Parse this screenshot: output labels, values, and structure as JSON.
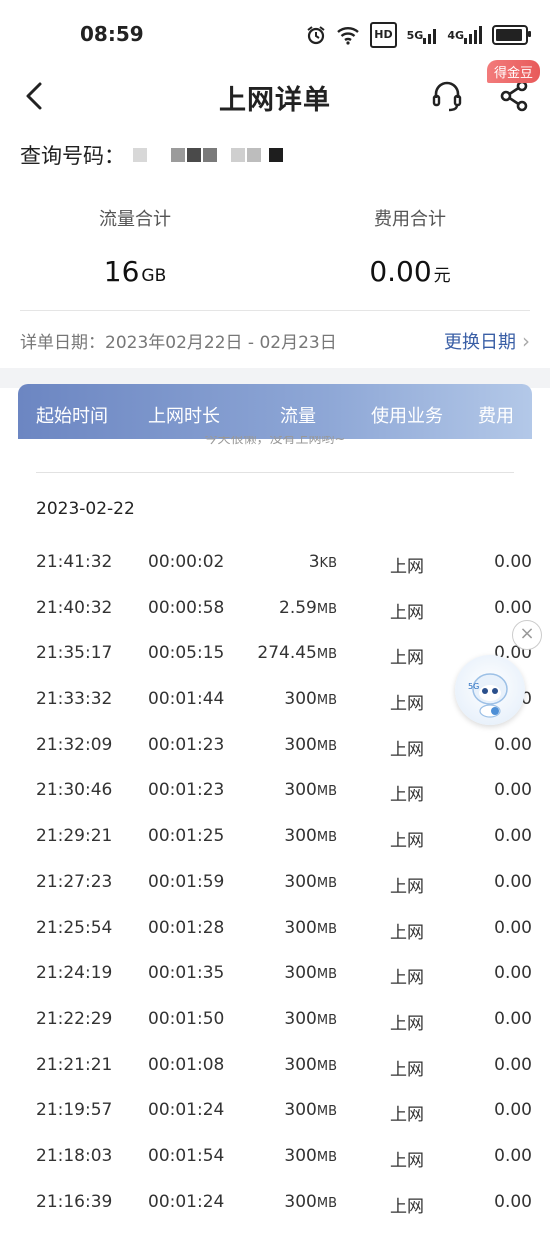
{
  "status_bar": {
    "time": "08:59",
    "hd_label": "HD",
    "net_5g": "5G",
    "net_4g": "4G"
  },
  "nav": {
    "title": "上网详单",
    "coin_badge": "得金豆"
  },
  "query": {
    "label": "查询号码："
  },
  "totals": {
    "traffic_label": "流量合计",
    "traffic_value": "16",
    "traffic_unit": "GB",
    "fee_label": "费用合计",
    "fee_value": "0.00",
    "fee_unit": "元"
  },
  "date_range": {
    "label": "详单日期：2023年02月22日 - 02月23日",
    "change_link": "更换日期"
  },
  "table": {
    "headers": [
      "起始时间",
      "上网时长",
      "流量",
      "使用业务",
      "费用"
    ],
    "empty_tip": "今天很懒，没有上网哟~",
    "group_date": "2023-02-22",
    "rows": [
      {
        "start": "21:41:32",
        "duration": "00:00:02",
        "traffic": "3",
        "unit": "KB",
        "business": "上网",
        "fee": "0.00"
      },
      {
        "start": "21:40:32",
        "duration": "00:00:58",
        "traffic": "2.59",
        "unit": "MB",
        "business": "上网",
        "fee": "0.00"
      },
      {
        "start": "21:35:17",
        "duration": "00:05:15",
        "traffic": "274.45",
        "unit": "MB",
        "business": "上网",
        "fee": "0.00"
      },
      {
        "start": "21:33:32",
        "duration": "00:01:44",
        "traffic": "300",
        "unit": "MB",
        "business": "上网",
        "fee": "0.00"
      },
      {
        "start": "21:32:09",
        "duration": "00:01:23",
        "traffic": "300",
        "unit": "MB",
        "business": "上网",
        "fee": "0.00"
      },
      {
        "start": "21:30:46",
        "duration": "00:01:23",
        "traffic": "300",
        "unit": "MB",
        "business": "上网",
        "fee": "0.00"
      },
      {
        "start": "21:29:21",
        "duration": "00:01:25",
        "traffic": "300",
        "unit": "MB",
        "business": "上网",
        "fee": "0.00"
      },
      {
        "start": "21:27:23",
        "duration": "00:01:59",
        "traffic": "300",
        "unit": "MB",
        "business": "上网",
        "fee": "0.00"
      },
      {
        "start": "21:25:54",
        "duration": "00:01:28",
        "traffic": "300",
        "unit": "MB",
        "business": "上网",
        "fee": "0.00"
      },
      {
        "start": "21:24:19",
        "duration": "00:01:35",
        "traffic": "300",
        "unit": "MB",
        "business": "上网",
        "fee": "0.00"
      },
      {
        "start": "21:22:29",
        "duration": "00:01:50",
        "traffic": "300",
        "unit": "MB",
        "business": "上网",
        "fee": "0.00"
      },
      {
        "start": "21:21:21",
        "duration": "00:01:08",
        "traffic": "300",
        "unit": "MB",
        "business": "上网",
        "fee": "0.00"
      },
      {
        "start": "21:19:57",
        "duration": "00:01:24",
        "traffic": "300",
        "unit": "MB",
        "business": "上网",
        "fee": "0.00"
      },
      {
        "start": "21:18:03",
        "duration": "00:01:54",
        "traffic": "300",
        "unit": "MB",
        "business": "上网",
        "fee": "0.00"
      },
      {
        "start": "21:16:39",
        "duration": "00:01:24",
        "traffic": "300",
        "unit": "MB",
        "business": "上网",
        "fee": "0.00"
      }
    ]
  },
  "floating": {
    "assistant_badge": "5G"
  },
  "colors": {
    "accent_link": "#3a5fa6",
    "header_gradient_start": "#6c86c2",
    "header_gradient_end": "#b3c8e8",
    "badge_red": "#e85a5a"
  },
  "icons": [
    "alarm-icon",
    "wifi-icon",
    "signal-icon",
    "battery-icon",
    "back-icon",
    "headset-icon",
    "share-icon",
    "chevron-right-icon",
    "close-icon",
    "assistant-mascot-icon"
  ]
}
